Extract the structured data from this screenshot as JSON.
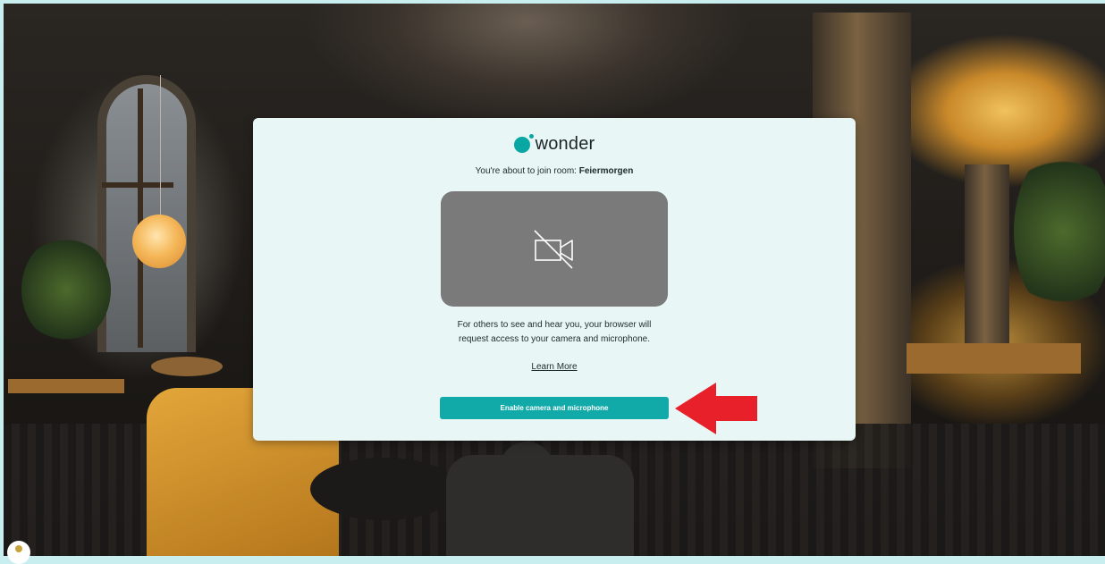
{
  "app": {
    "name": "wonder"
  },
  "join": {
    "prefix": "You're about to join room: ",
    "room_name": "Feiermorgen"
  },
  "camera_preview": {
    "state_icon": "camera-off-icon"
  },
  "info": {
    "line1": "For others to see and hear you, your browser will",
    "line2": "request access to your camera and microphone."
  },
  "learn_more": {
    "label": "Learn More"
  },
  "enable_button": {
    "label": "Enable camera and microphone"
  },
  "annotation": {
    "arrow_color": "#e8202a"
  },
  "colors": {
    "accent": "#11aaa9",
    "modal_bg": "#e8f6f6",
    "preview_bg": "#7a7a7a"
  }
}
